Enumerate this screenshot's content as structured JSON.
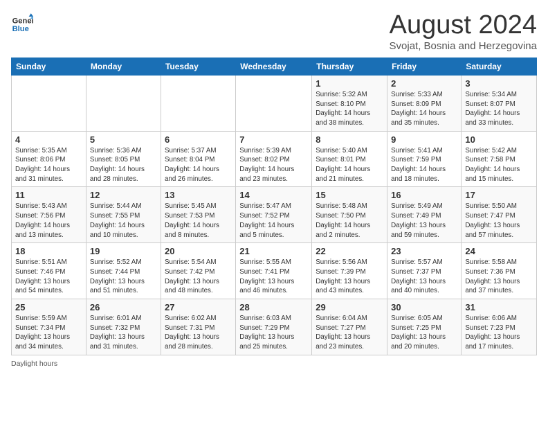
{
  "header": {
    "logo_line1": "General",
    "logo_line2": "Blue",
    "main_title": "August 2024",
    "subtitle": "Svojat, Bosnia and Herzegovina"
  },
  "days_of_week": [
    "Sunday",
    "Monday",
    "Tuesday",
    "Wednesday",
    "Thursday",
    "Friday",
    "Saturday"
  ],
  "weeks": [
    [
      {
        "day": "",
        "info": ""
      },
      {
        "day": "",
        "info": ""
      },
      {
        "day": "",
        "info": ""
      },
      {
        "day": "",
        "info": ""
      },
      {
        "day": "1",
        "info": "Sunrise: 5:32 AM\nSunset: 8:10 PM\nDaylight: 14 hours\nand 38 minutes."
      },
      {
        "day": "2",
        "info": "Sunrise: 5:33 AM\nSunset: 8:09 PM\nDaylight: 14 hours\nand 35 minutes."
      },
      {
        "day": "3",
        "info": "Sunrise: 5:34 AM\nSunset: 8:07 PM\nDaylight: 14 hours\nand 33 minutes."
      }
    ],
    [
      {
        "day": "4",
        "info": "Sunrise: 5:35 AM\nSunset: 8:06 PM\nDaylight: 14 hours\nand 31 minutes."
      },
      {
        "day": "5",
        "info": "Sunrise: 5:36 AM\nSunset: 8:05 PM\nDaylight: 14 hours\nand 28 minutes."
      },
      {
        "day": "6",
        "info": "Sunrise: 5:37 AM\nSunset: 8:04 PM\nDaylight: 14 hours\nand 26 minutes."
      },
      {
        "day": "7",
        "info": "Sunrise: 5:39 AM\nSunset: 8:02 PM\nDaylight: 14 hours\nand 23 minutes."
      },
      {
        "day": "8",
        "info": "Sunrise: 5:40 AM\nSunset: 8:01 PM\nDaylight: 14 hours\nand 21 minutes."
      },
      {
        "day": "9",
        "info": "Sunrise: 5:41 AM\nSunset: 7:59 PM\nDaylight: 14 hours\nand 18 minutes."
      },
      {
        "day": "10",
        "info": "Sunrise: 5:42 AM\nSunset: 7:58 PM\nDaylight: 14 hours\nand 15 minutes."
      }
    ],
    [
      {
        "day": "11",
        "info": "Sunrise: 5:43 AM\nSunset: 7:56 PM\nDaylight: 14 hours\nand 13 minutes."
      },
      {
        "day": "12",
        "info": "Sunrise: 5:44 AM\nSunset: 7:55 PM\nDaylight: 14 hours\nand 10 minutes."
      },
      {
        "day": "13",
        "info": "Sunrise: 5:45 AM\nSunset: 7:53 PM\nDaylight: 14 hours\nand 8 minutes."
      },
      {
        "day": "14",
        "info": "Sunrise: 5:47 AM\nSunset: 7:52 PM\nDaylight: 14 hours\nand 5 minutes."
      },
      {
        "day": "15",
        "info": "Sunrise: 5:48 AM\nSunset: 7:50 PM\nDaylight: 14 hours\nand 2 minutes."
      },
      {
        "day": "16",
        "info": "Sunrise: 5:49 AM\nSunset: 7:49 PM\nDaylight: 13 hours\nand 59 minutes."
      },
      {
        "day": "17",
        "info": "Sunrise: 5:50 AM\nSunset: 7:47 PM\nDaylight: 13 hours\nand 57 minutes."
      }
    ],
    [
      {
        "day": "18",
        "info": "Sunrise: 5:51 AM\nSunset: 7:46 PM\nDaylight: 13 hours\nand 54 minutes."
      },
      {
        "day": "19",
        "info": "Sunrise: 5:52 AM\nSunset: 7:44 PM\nDaylight: 13 hours\nand 51 minutes."
      },
      {
        "day": "20",
        "info": "Sunrise: 5:54 AM\nSunset: 7:42 PM\nDaylight: 13 hours\nand 48 minutes."
      },
      {
        "day": "21",
        "info": "Sunrise: 5:55 AM\nSunset: 7:41 PM\nDaylight: 13 hours\nand 46 minutes."
      },
      {
        "day": "22",
        "info": "Sunrise: 5:56 AM\nSunset: 7:39 PM\nDaylight: 13 hours\nand 43 minutes."
      },
      {
        "day": "23",
        "info": "Sunrise: 5:57 AM\nSunset: 7:37 PM\nDaylight: 13 hours\nand 40 minutes."
      },
      {
        "day": "24",
        "info": "Sunrise: 5:58 AM\nSunset: 7:36 PM\nDaylight: 13 hours\nand 37 minutes."
      }
    ],
    [
      {
        "day": "25",
        "info": "Sunrise: 5:59 AM\nSunset: 7:34 PM\nDaylight: 13 hours\nand 34 minutes."
      },
      {
        "day": "26",
        "info": "Sunrise: 6:01 AM\nSunset: 7:32 PM\nDaylight: 13 hours\nand 31 minutes."
      },
      {
        "day": "27",
        "info": "Sunrise: 6:02 AM\nSunset: 7:31 PM\nDaylight: 13 hours\nand 28 minutes."
      },
      {
        "day": "28",
        "info": "Sunrise: 6:03 AM\nSunset: 7:29 PM\nDaylight: 13 hours\nand 25 minutes."
      },
      {
        "day": "29",
        "info": "Sunrise: 6:04 AM\nSunset: 7:27 PM\nDaylight: 13 hours\nand 23 minutes."
      },
      {
        "day": "30",
        "info": "Sunrise: 6:05 AM\nSunset: 7:25 PM\nDaylight: 13 hours\nand 20 minutes."
      },
      {
        "day": "31",
        "info": "Sunrise: 6:06 AM\nSunset: 7:23 PM\nDaylight: 13 hours\nand 17 minutes."
      }
    ]
  ],
  "footer": {
    "daylight_label": "Daylight hours"
  }
}
